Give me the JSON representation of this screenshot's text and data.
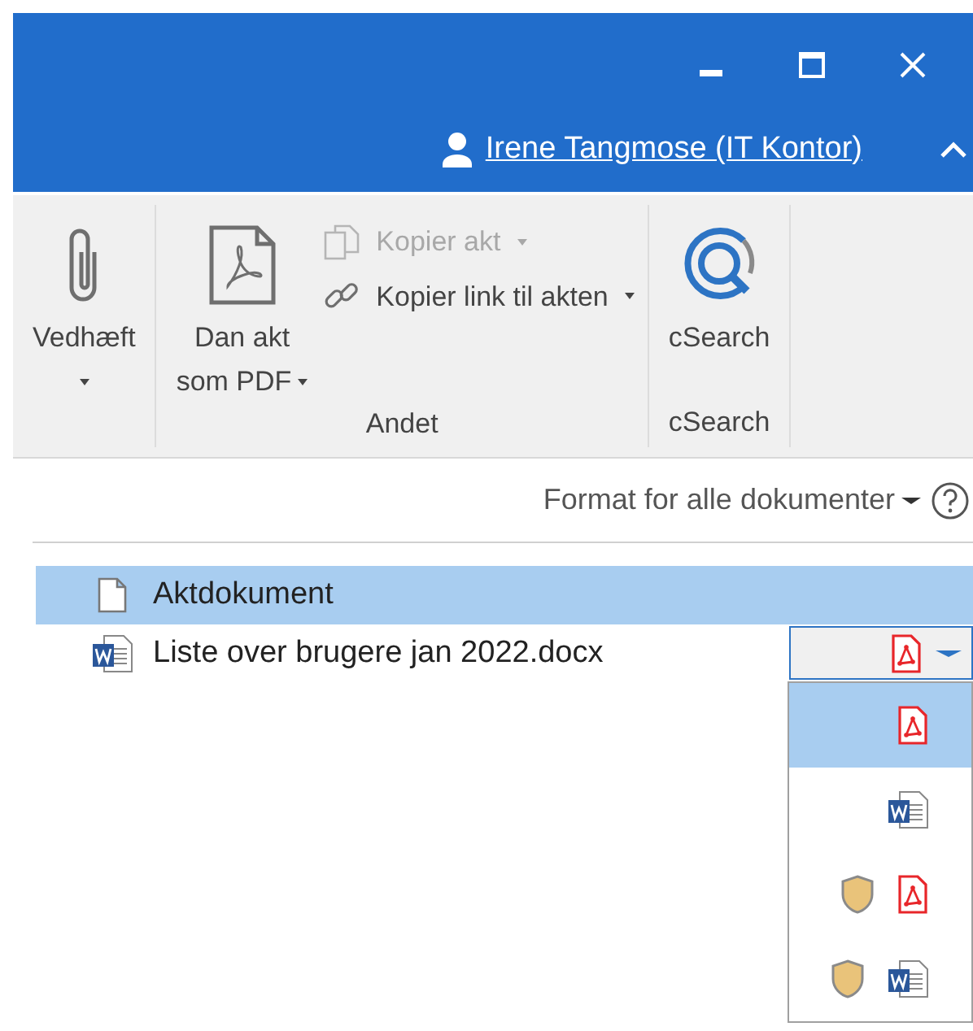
{
  "title_bar": {
    "controls": [
      {
        "kind": "minimize"
      },
      {
        "kind": "maximize"
      },
      {
        "kind": "close"
      }
    ],
    "user": "Irene Tangmose (IT Kontor)",
    "ribbon_collapse": {
      "kind": "chevron"
    }
  },
  "ribbon": {
    "groups": [
      {
        "buttons": [
          {
            "kind": "attach",
            "lines": [
              "Vedhæft"
            ],
            "dropdown": true,
            "disabled": false
          }
        ]
      },
      {
        "label": "Andet",
        "buttons": [
          {
            "kind": "pdf",
            "lines": [
              "Dan akt",
              "som PDF"
            ],
            "dropdown": true,
            "disabled": false
          },
          {
            "kind": "copy",
            "lines": [
              "Kopier akt"
            ],
            "dropdown": true,
            "disabled": true
          },
          {
            "kind": "link",
            "lines": [
              "Kopier link til akten"
            ],
            "dropdown": true,
            "disabled": false
          }
        ]
      },
      {
        "label": "cSearch",
        "buttons": [
          {
            "kind": "search",
            "lines": [
              "cSearch"
            ],
            "dropdown": false,
            "disabled": false
          }
        ]
      }
    ]
  },
  "format_menu": {
    "label": "Format for alle dokumenter"
  },
  "documents": [
    {
      "kind": "blank",
      "name": "Aktdokument",
      "selected": true
    },
    {
      "kind": "word",
      "name": "Liste over brugere jan 2022.docx",
      "selected": false,
      "format": {
        "kind": "pdf",
        "expanded": true,
        "options": [
          {
            "kind": "pdf",
            "protected": false,
            "selected": true
          },
          {
            "kind": "word",
            "protected": false,
            "selected": false
          },
          {
            "kind": "pdf",
            "protected": true,
            "selected": false
          },
          {
            "kind": "word",
            "protected": true,
            "selected": false
          }
        ]
      }
    }
  ]
}
